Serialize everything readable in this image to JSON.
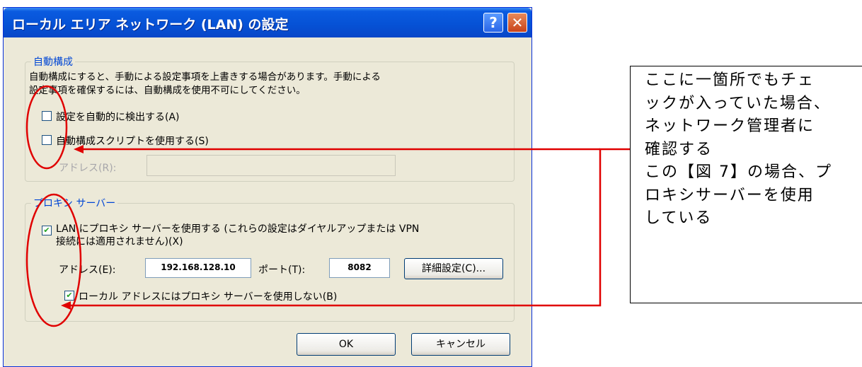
{
  "dialog": {
    "title": "ローカル エリア ネットワーク (LAN) の設定",
    "help_button": "?",
    "close_button": "✕",
    "auto_config": {
      "legend": "自動構成",
      "desc_line1": "自動構成にすると、手動による設定事項を上書きする場合があります。手動による",
      "desc_line2": "設定事項を確保するには、自動構成を使用不可にしてください。",
      "detect_label": "設定を自動的に検出する(A)",
      "detect_checked": false,
      "script_label": "自動構成スクリプトを使用する(S)",
      "script_checked": false,
      "address_label": "アドレス(R):",
      "address_value": ""
    },
    "proxy": {
      "legend": "プロキシ サーバー",
      "use_proxy_line1": "LAN にプロキシ サーバーを使用する (これらの設定はダイヤルアップまたは VPN",
      "use_proxy_line2": "接続には適用されません)(X)",
      "use_proxy_checked": true,
      "address_label": "アドレス(E):",
      "address_value": "192.168.128.10",
      "port_label": "ポート(T):",
      "port_value": "8082",
      "advanced_button": "詳細設定(C)...",
      "bypass_label": "ローカル アドレスにはプロキシ サーバーを使用しない(B)",
      "bypass_checked": true
    },
    "ok_button": "OK",
    "cancel_button": "キャンセル"
  },
  "annotation": {
    "lines": [
      "ここに一箇所でもチェ",
      "ックが入っていた場合、",
      "ネットワーク管理者に",
      "確認する",
      "この【図 7】の場合、プ",
      "ロキシサーバーを使用",
      "している"
    ],
    "color": "#e00000"
  }
}
